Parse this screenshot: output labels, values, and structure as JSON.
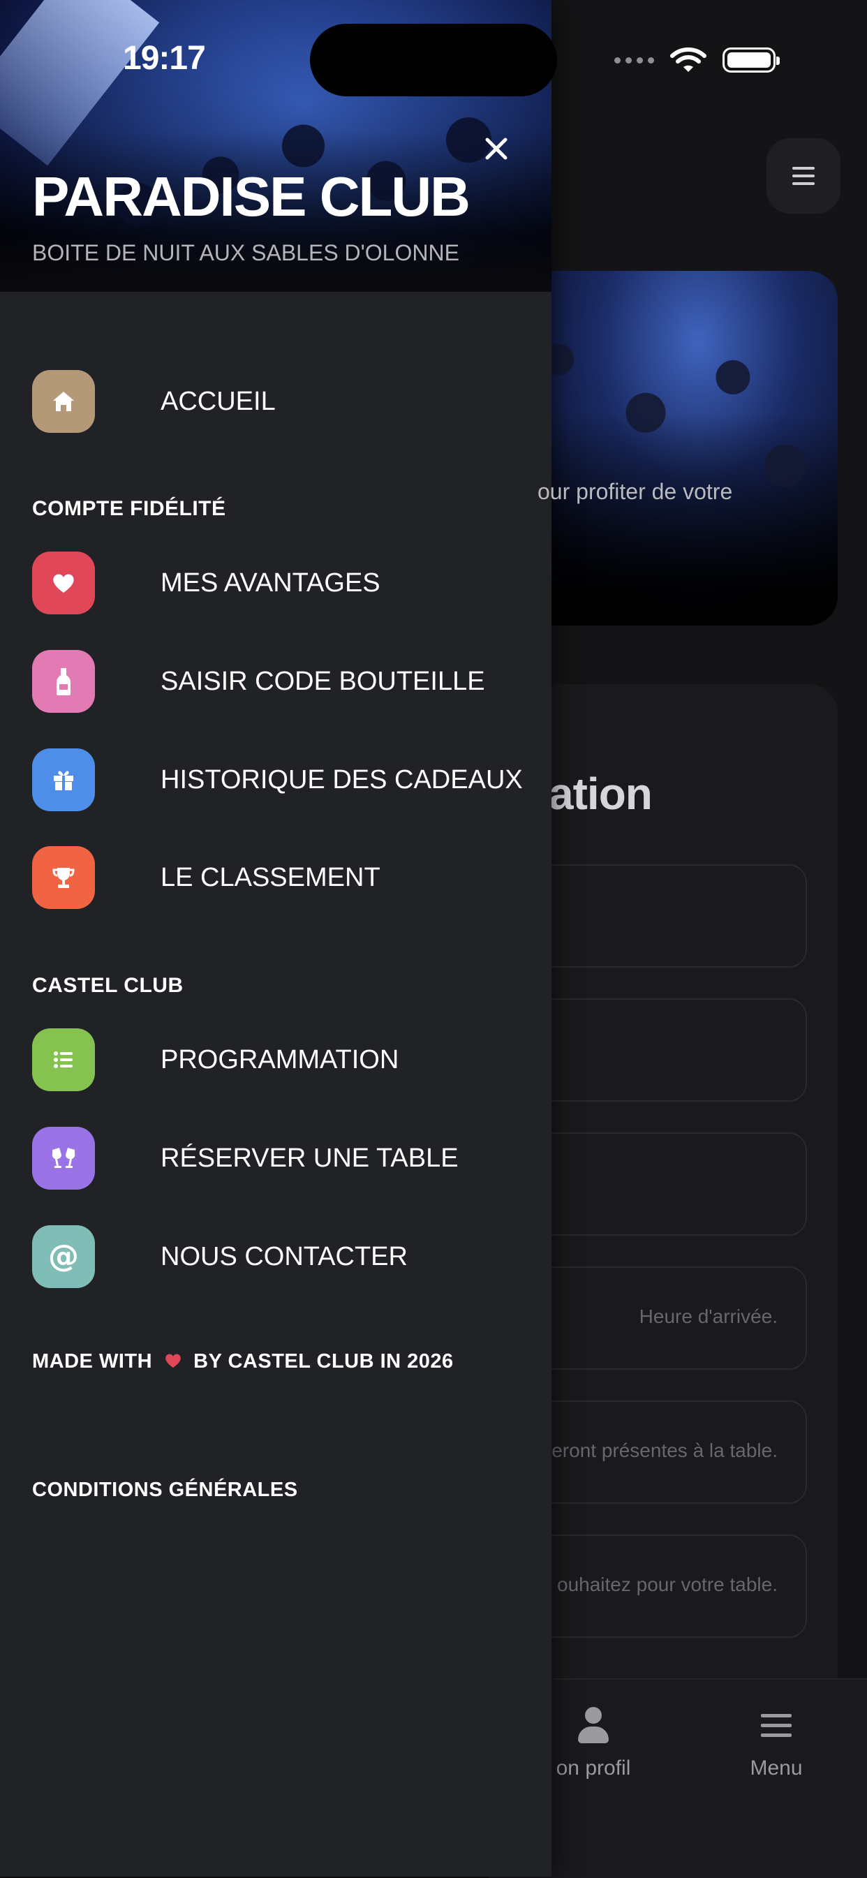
{
  "status_bar": {
    "time": "19:17"
  },
  "background": {
    "hero_text": "our profiter de votre",
    "section_title": "ation",
    "field_placeholders": [
      "",
      "",
      "",
      "Heure d'arrivée.",
      "eront présentes à la table.",
      "ouhaitez pour votre table."
    ],
    "tabs": [
      {
        "label": "on profil",
        "icon": "person-icon"
      },
      {
        "label": "Menu",
        "icon": "menu-icon"
      }
    ]
  },
  "drawer": {
    "title": "PARADISE CLUB",
    "subtitle": "BOITE DE NUIT AUX SABLES D'OLONNE",
    "home": {
      "label": "ACCUEIL",
      "icon": "home-icon",
      "color": "#b39977"
    },
    "loyalty_section": "COMPTE FIDÉLITÉ",
    "loyalty_items": [
      {
        "label": "MES AVANTAGES",
        "icon": "heart-icon",
        "color": "#e0485a"
      },
      {
        "label": "SAISIR CODE BOUTEILLE",
        "icon": "bottle-icon",
        "color": "#e27bb4"
      },
      {
        "label": "HISTORIQUE DES CADEAUX",
        "icon": "gift-icon",
        "color": "#4f8ee8"
      },
      {
        "label": "LE CLASSEMENT",
        "icon": "trophy-icon",
        "color": "#f06443"
      }
    ],
    "club_section": "CASTEL CLUB",
    "club_items": [
      {
        "label": "PROGRAMMATION",
        "icon": "list-icon",
        "color": "#86c250"
      },
      {
        "label": "RÉSERVER UNE TABLE",
        "icon": "champagne-glasses-icon",
        "color": "#9a74e6"
      },
      {
        "label": "NOUS CONTACTER",
        "icon": "at-icon",
        "color": "#80bdb7"
      }
    ],
    "footer_made_prefix": "MADE WITH",
    "footer_made_suffix": "BY CASTEL CLUB IN 2026",
    "footer_heart_color": "#e0485a",
    "conditions": "CONDITIONS GÉNÉRALES"
  }
}
